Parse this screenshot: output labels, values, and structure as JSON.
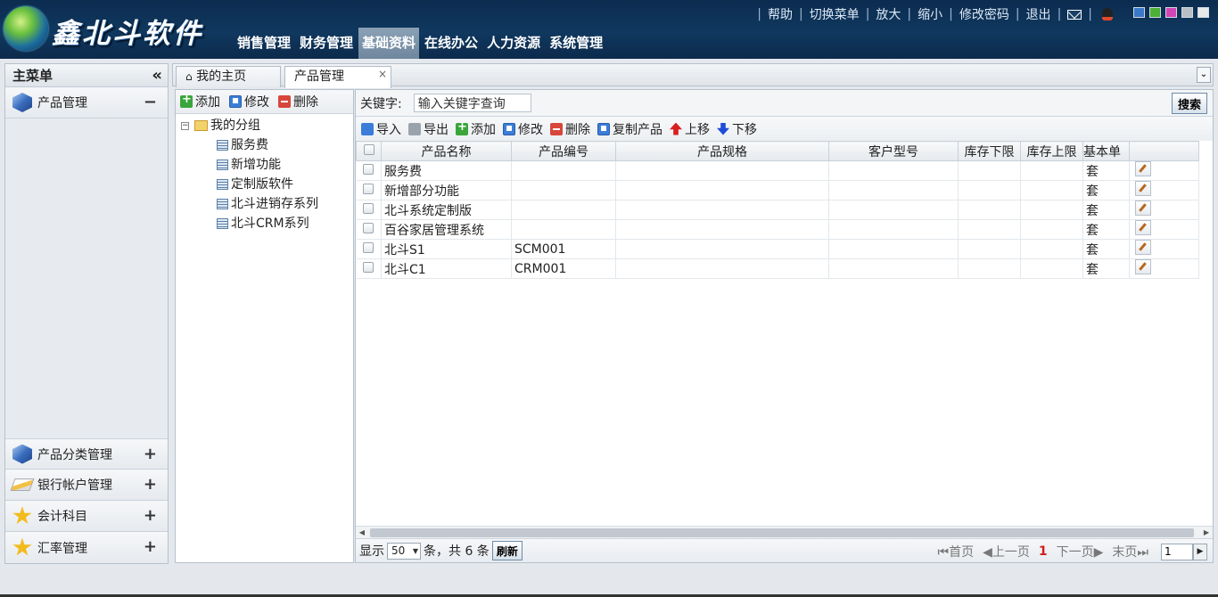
{
  "header": {
    "logo_text": "鑫北斗软件",
    "top_links": [
      "帮助",
      "切换菜单",
      "放大",
      "缩小",
      "修改密码",
      "退出"
    ],
    "skin_colors": [
      "#3a78c8",
      "#4bb034",
      "#d246b4",
      "#b9bec4",
      "#e8e8e8"
    ],
    "nav": [
      "销售管理",
      "财务管理",
      "基础资料",
      "在线办公",
      "人力资源",
      "系统管理"
    ],
    "active_nav": "基础资料"
  },
  "sidebar": {
    "title": "主菜单",
    "collapse_icon": "«",
    "active_item": {
      "label": "产品管理",
      "toggle": "−",
      "icon": "cube-icon"
    },
    "bottom_items": [
      {
        "label": "产品分类管理",
        "toggle": "+",
        "icon": "cube-icon"
      },
      {
        "label": "银行帐户管理",
        "toggle": "+",
        "icon": "bank-card-icon"
      },
      {
        "label": "会计科目",
        "toggle": "+",
        "icon": "star-icon"
      },
      {
        "label": "汇率管理",
        "toggle": "+",
        "icon": "star-icon"
      }
    ]
  },
  "tabs": {
    "home": "我的主页",
    "current": "产品管理",
    "close": "×"
  },
  "tree": {
    "toolbar": {
      "add": "添加",
      "edit": "修改",
      "delete": "删除"
    },
    "root": "我的分组",
    "children": [
      "服务费",
      "新增功能",
      "定制版软件",
      "北斗进销存系列",
      "北斗CRM系列"
    ]
  },
  "search": {
    "label": "关键字:",
    "placeholder": "输入关键字查询",
    "button": "搜索"
  },
  "grid_toolbar": {
    "import": "导入",
    "export": "导出",
    "add": "添加",
    "edit": "修改",
    "delete": "删除",
    "copy": "复制产品",
    "up": "上移",
    "down": "下移"
  },
  "grid": {
    "columns": [
      "产品名称",
      "产品编号",
      "产品规格",
      "客户型号",
      "库存下限",
      "库存上限",
      "基本单"
    ],
    "rows": [
      {
        "name": "服务费",
        "code": "",
        "spec": "",
        "model": "",
        "min": "",
        "max": "",
        "unit": "套"
      },
      {
        "name": "新增部分功能",
        "code": "",
        "spec": "",
        "model": "",
        "min": "",
        "max": "",
        "unit": "套"
      },
      {
        "name": "北斗系统定制版",
        "code": "",
        "spec": "",
        "model": "",
        "min": "",
        "max": "",
        "unit": "套"
      },
      {
        "name": "百谷家居管理系统",
        "code": "",
        "spec": "",
        "model": "",
        "min": "",
        "max": "",
        "unit": "套"
      },
      {
        "name": "北斗S1",
        "code": "SCM001",
        "spec": "",
        "model": "",
        "min": "",
        "max": "",
        "unit": "套"
      },
      {
        "name": "北斗C1",
        "code": "CRM001",
        "spec": "",
        "model": "",
        "min": "",
        "max": "",
        "unit": "套"
      }
    ]
  },
  "pager": {
    "show": "显示",
    "page_size": "50",
    "summary": "条，共 6 条",
    "refresh": "刷新",
    "first": "首页",
    "prev": "上一页",
    "current": "1",
    "next": "下一页",
    "last": "末页",
    "page_input": "1"
  }
}
